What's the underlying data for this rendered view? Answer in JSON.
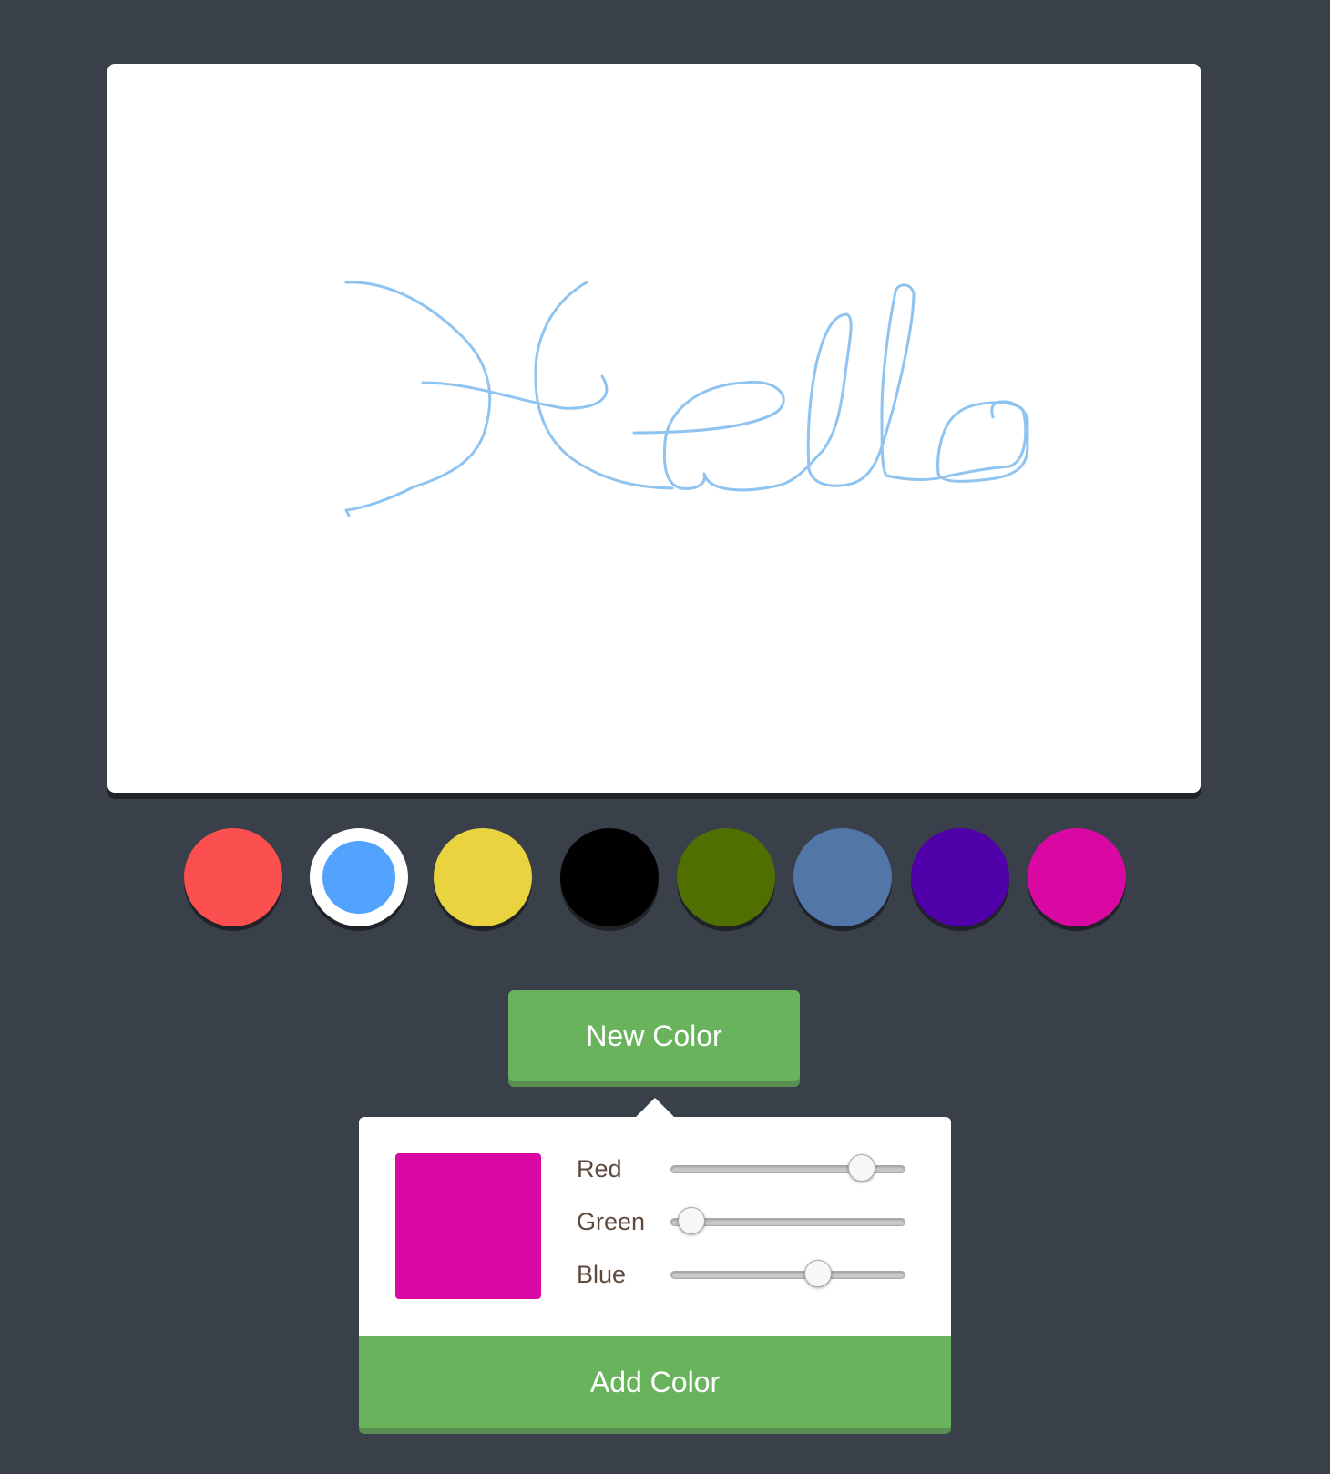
{
  "canvas": {
    "stroke_color": "#8fc3f0"
  },
  "palette": {
    "selected_index": 1,
    "colors": [
      "#fc4f4f",
      "#52a3fd",
      "#e9d33f",
      "#000000",
      "#4f7000",
      "#5376a8",
      "#5000a8",
      "#d908a3"
    ]
  },
  "new_color_button": {
    "label": "New Color"
  },
  "picker": {
    "preview_color": "#d908a3",
    "sliders": [
      {
        "label": "Red",
        "value": 217,
        "max": 255
      },
      {
        "label": "Green",
        "value": 8,
        "max": 255
      },
      {
        "label": "Blue",
        "value": 163,
        "max": 255
      }
    ],
    "add_button_label": "Add Color"
  }
}
